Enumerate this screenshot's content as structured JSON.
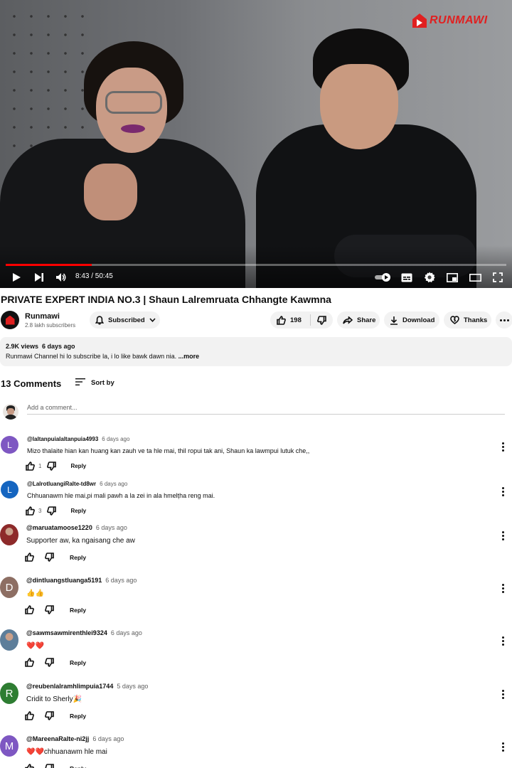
{
  "player": {
    "channel_logo_text": "RUNMAWI",
    "time_display": "8:43 / 50:45",
    "progress_fraction": 0.172
  },
  "video": {
    "title": "PRIVATE EXPERT INDIA NO.3 | Shaun Lalremruata Chhangte Kawmna",
    "channel_name": "Runmawi",
    "subscribers": "2.8 lakh subscribers",
    "subscribe_label": "Subscribed",
    "like_count": "198",
    "share_label": "Share",
    "download_label": "Download",
    "thanks_label": "Thanks"
  },
  "description": {
    "meta": "2.9K views  6 days ago",
    "text": "Runmawi Channel hi lo subscribe la, i lo like bawk dawn nia.",
    "more": "...more"
  },
  "comments_header": {
    "count": "13 Comments",
    "sort_label": "Sort by",
    "add_placeholder": "Add a comment..."
  },
  "comments": [
    {
      "author": "@laltanpuialaltanpuia4993",
      "time": "6 days ago",
      "text": "Mizo thalaite hian kan huang kan zauh ve ta hle mai, thil ropui tak ani, Shaun ka lawmpui lutuk che,,",
      "likes": "1",
      "reply": "Reply",
      "avatar_letter": "L",
      "avatar_color": "#7e57c2"
    },
    {
      "author": "@LalrotluangiRalte-td8wr",
      "time": "6 days ago",
      "text": "Chhuanawm hle mai,pi mali pawh a la zei in ala hmelțha reng mai.",
      "likes": "3",
      "reply": "Reply",
      "avatar_letter": "L",
      "avatar_color": "#1565c0"
    },
    {
      "author": "@maruatamoose1220",
      "time": "6 days ago",
      "text": "Supporter aw, ka ngaisang che aw",
      "likes": "",
      "reply": "Reply",
      "avatar_letter": "",
      "avatar_color": "#8d2a2a"
    },
    {
      "author": "@dintluangstluanga5191",
      "time": "6 days ago",
      "text": "👍👍",
      "likes": "",
      "reply": "Reply",
      "avatar_letter": "D",
      "avatar_color": "#8d6e63"
    },
    {
      "author": "@sawmsawmirenthlei9324",
      "time": "6 days ago",
      "text": "❤️❤️",
      "likes": "",
      "reply": "Reply",
      "avatar_letter": "",
      "avatar_color": "#5d7e9a"
    },
    {
      "author": "@reubenlalramhlimpuia1744",
      "time": "5 days ago",
      "text": "Cridit to Sherly🎉",
      "likes": "",
      "reply": "Reply",
      "avatar_letter": "R",
      "avatar_color": "#2e7d32"
    },
    {
      "author": "@MareenaRalte-ni2jj",
      "time": "6 days ago",
      "text": "❤️❤️chhuanawm hle mai",
      "likes": "",
      "reply": "Reply",
      "avatar_letter": "M",
      "avatar_color": "#7e57c2"
    }
  ]
}
